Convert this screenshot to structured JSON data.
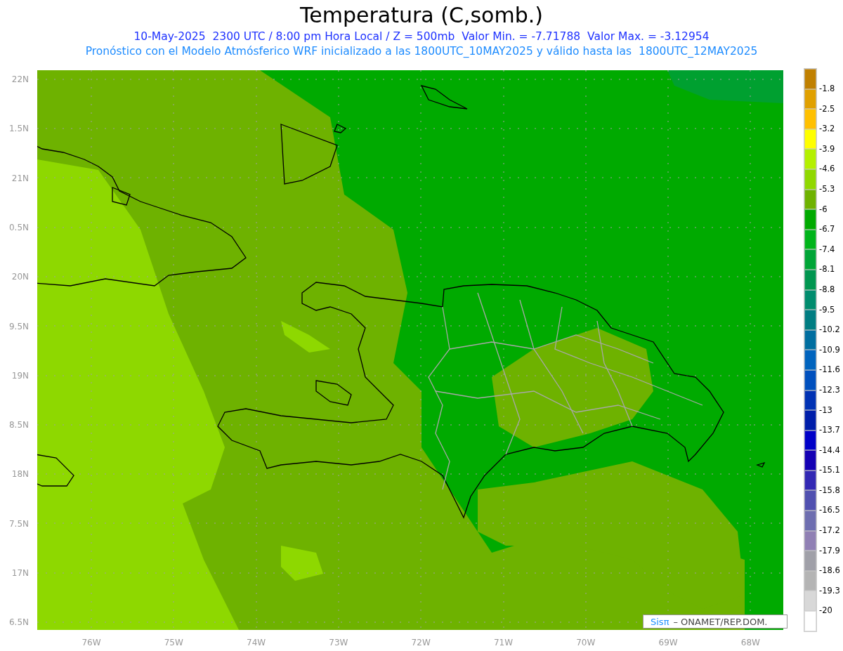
{
  "title": "Temperatura (C,somb.)",
  "subtitle": "10-May-2025  2300 UTC / 8:00 pm Hora Local / Z = 500mb  Valor Min. = -7.71788  Valor Max. = -3.12954",
  "description": "Pronóstico con el Modelo Atmósferico WRF inicializado a las 1800UTC_10MAY2025 y válido hasta las  1800UTC_12MAY2025",
  "map": {
    "lat_labels": [
      "22N",
      "1.5N",
      "21N",
      "0.5N",
      "20N",
      "9.5N",
      "19N",
      "8.5N",
      "18N",
      "7.5N",
      "17N",
      "6.5N"
    ],
    "lon_labels": [
      "76W",
      "75W",
      "74W",
      "73W",
      "72W",
      "71W",
      "70W",
      "69W",
      "68W"
    ],
    "credit": {
      "logo": "Sisπ",
      "text": "– ONAMET/REP.DOM."
    }
  },
  "colorbar": {
    "boxes": [
      {
        "color": "#c08000"
      },
      {
        "color": "#e0a000"
      },
      {
        "color": "#ffc000"
      },
      {
        "color": "#ffff00"
      },
      {
        "color": "#b4f000"
      },
      {
        "color": "#90d800"
      },
      {
        "color": "#6eb200"
      },
      {
        "color": "#00aa00"
      },
      {
        "color": "#00b41a"
      },
      {
        "color": "#00a537"
      },
      {
        "color": "#009650"
      },
      {
        "color": "#008c6e"
      },
      {
        "color": "#007d82"
      },
      {
        "color": "#006ea0"
      },
      {
        "color": "#0064be"
      },
      {
        "color": "#0050be"
      },
      {
        "color": "#0032b4"
      },
      {
        "color": "#001eaa"
      },
      {
        "color": "#0000c8"
      },
      {
        "color": "#1400b4"
      },
      {
        "color": "#3228b4"
      },
      {
        "color": "#5050b0"
      },
      {
        "color": "#6e6eb0"
      },
      {
        "color": "#9080b4"
      },
      {
        "color": "#a0a0a8"
      },
      {
        "color": "#b4b4b4"
      },
      {
        "color": "#d8d8d8"
      },
      {
        "color": "#ffffff"
      }
    ],
    "labels": [
      "-1.8",
      "-2.5",
      "-3.2",
      "-3.9",
      "-4.6",
      "-5.3",
      "-6",
      "-6.7",
      "-7.4",
      "-8.1",
      "-8.8",
      "-9.5",
      "-10.2",
      "-10.9",
      "-11.6",
      "-12.3",
      "-13",
      "-13.7",
      "-14.4",
      "-15.1",
      "-15.8",
      "-16.5",
      "-17.2",
      "-17.9",
      "-18.6",
      "-19.3",
      "-20"
    ]
  }
}
